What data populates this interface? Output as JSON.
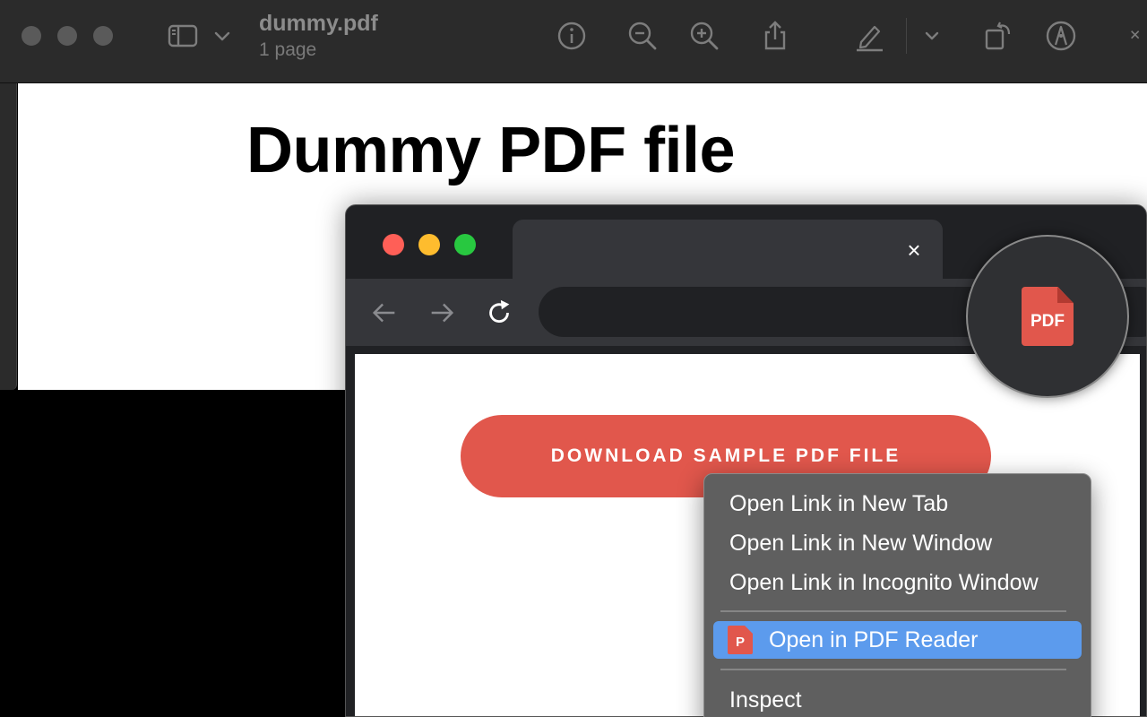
{
  "preview": {
    "document_title": "dummy.pdf",
    "page_count": "1 page",
    "heading": "Dummy PDF file"
  },
  "browser": {
    "tab_close": "×",
    "download_button": "DOWNLOAD SAMPLE PDF FILE"
  },
  "extension": {
    "badge_label": "PDF"
  },
  "context_menu": {
    "items": [
      "Open Link in New Tab",
      "Open Link in New Window",
      "Open Link in Incognito Window",
      "Open in PDF Reader",
      "Inspect"
    ],
    "reader_icon_letter": "P"
  },
  "colors": {
    "accent_red": "#e1574c",
    "menu_highlight": "#5c9bed",
    "traffic_red": "#ff5f57",
    "traffic_yellow": "#febc2e",
    "traffic_green": "#28c840"
  }
}
